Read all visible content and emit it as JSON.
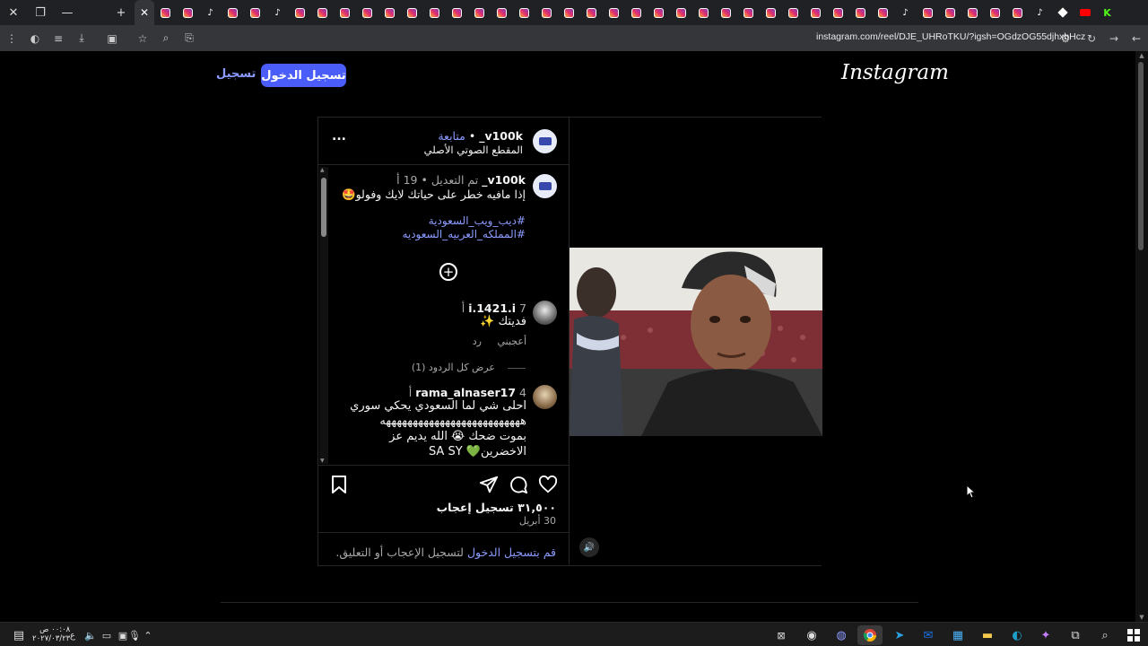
{
  "browser": {
    "url": "instagram.com/reel/DJE_UHRoTKU/?igsh=OGdzOG55djhxbHcz",
    "tab_icons": [
      "instagram-icon",
      "instagram-icon",
      "tiktok-icon",
      "instagram-icon",
      "instagram-icon",
      "tiktok-icon",
      "instagram-icon",
      "instagram-icon",
      "instagram-icon",
      "instagram-icon",
      "instagram-icon",
      "instagram-icon",
      "instagram-icon",
      "instagram-icon",
      "instagram-icon",
      "instagram-icon",
      "instagram-icon",
      "instagram-icon",
      "instagram-icon",
      "instagram-icon",
      "instagram-icon",
      "instagram-icon",
      "instagram-icon",
      "instagram-icon",
      "instagram-icon",
      "instagram-icon",
      "instagram-icon",
      "instagram-icon",
      "instagram-icon",
      "instagram-icon",
      "instagram-icon",
      "instagram-icon",
      "instagram-icon",
      "tiktok-icon",
      "instagram-icon",
      "instagram-icon",
      "instagram-icon",
      "instagram-icon",
      "instagram-icon",
      "tiktok-icon",
      "diamond-icon",
      "youtube-icon",
      "kick-icon"
    ]
  },
  "header": {
    "logo": "Instagram",
    "login_label": "تسجيل الدخول",
    "signup_label": "تسجيل"
  },
  "post": {
    "username": "v100k_",
    "separator": "•",
    "follow_label": "متابعة",
    "audio_label": "المقطع الصوتي الأصلي",
    "more_label": "...",
    "caption": {
      "username": "v100k_",
      "edited": "تم التعديل •",
      "age": "19 أ",
      "text": "إذا مافيه خطر على حياتك لايك وفولو🤩",
      "hashtag1": "#ديب_ويب_السعودية",
      "hashtag2": "#المملكه_العربيه_السعوديه"
    },
    "comments": [
      {
        "username": "i.1421.i",
        "age": "7 أ",
        "text": "فديتك ✨",
        "like_label": "أعجبني",
        "reply_label": "رد",
        "view_replies": "عرض كل الردود (1)"
      },
      {
        "username": "rama_alnaser17",
        "age": "4 أ",
        "line1": "احلى شي لما السعودي يحكي سوري",
        "line2": "ههههههههههههههههههههههههههه",
        "line3": "بموت ضحك 😭 الله يديم عز",
        "line4": "الاخضرين💚 SA SY"
      }
    ],
    "likes": "٣١,٥٠٠ تسجيل إعجاب",
    "date": "30 أبريل",
    "login_prompt_link": "قم بتسجيل الدخول",
    "login_prompt_rest": " لتسجيل الإعجاب أو التعليق."
  },
  "taskbar": {
    "time": "٠٠:٠٨ ص",
    "date": "٢٠٢٧/٠٣/٢٣",
    "lang": "ع"
  }
}
